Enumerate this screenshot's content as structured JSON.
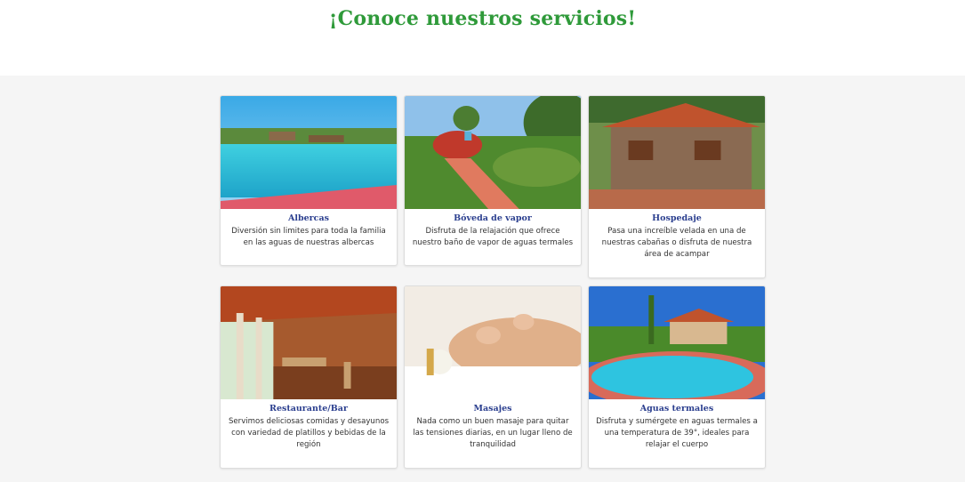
{
  "header": {
    "title": "¡Conoce nuestros servicios!"
  },
  "colors": {
    "title_green": "#2f9a3a",
    "card_title_blue": "#2b3f8f"
  },
  "services": [
    {
      "title": "Albercas",
      "description": "Diversión sin limites para toda la familia en las aguas de nuestras albercas"
    },
    {
      "title": "Bóveda de vapor",
      "description": "Disfruta de la relajación que ofrece nuestro baño de vapor de aguas termales"
    },
    {
      "title": "Hospedaje",
      "description": "Pasa una increíble velada en una de nuestras cabañas o disfruta de nuestra área de acampar"
    },
    {
      "title": "Restaurante/Bar",
      "description": "Servimos deliciosas comidas y desayunos con variedad de platillos y bebidas de la región"
    },
    {
      "title": "Masajes",
      "description": "Nada como un buen masaje para quitar las tensiones diarias, en un lugar lleno de tranquilidad"
    },
    {
      "title": "Aguas termales",
      "description": "Disfruta y sumérgete en aguas termales a una temperatura de 39°, ideales para relajar el cuerpo"
    }
  ]
}
